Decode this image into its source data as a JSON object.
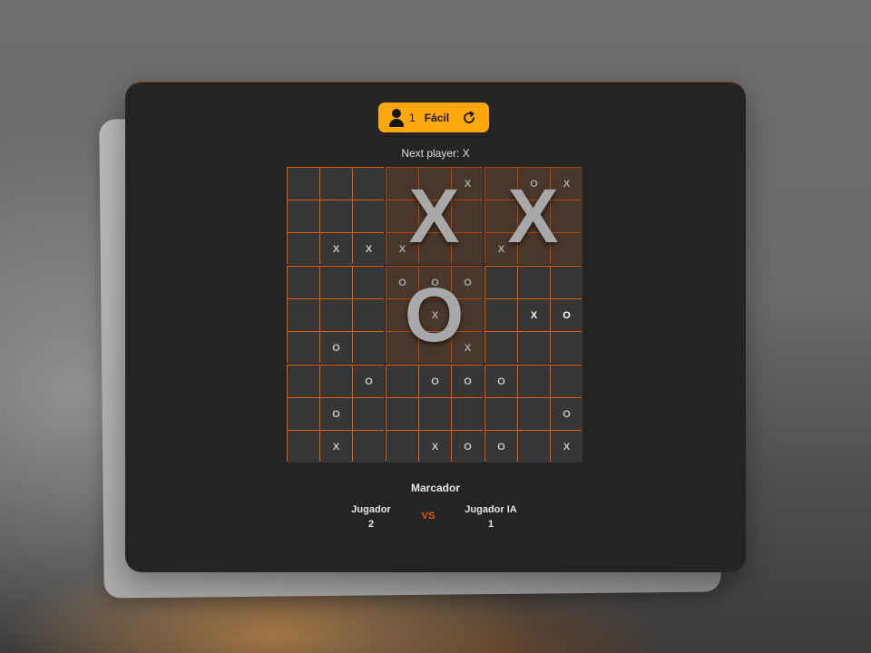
{
  "topbar": {
    "player_icon": "user-icon",
    "player_count": "1",
    "difficulty": "Fácil",
    "restart_icon": "refresh-icon",
    "accent_color": "#ffa70b"
  },
  "status": "Next player: X",
  "board": {
    "next_player": "X",
    "highlight_color": "#e65c00",
    "sub_boards": [
      {
        "winner": "",
        "cells": [
          "",
          "",
          "",
          "",
          "",
          "",
          "",
          "X",
          "X"
        ]
      },
      {
        "winner": "X",
        "cells": [
          "",
          "",
          "X",
          "",
          "",
          "",
          "X",
          "",
          ""
        ]
      },
      {
        "winner": "X",
        "cells": [
          "",
          "O",
          "X",
          "",
          "",
          "",
          "X",
          "",
          ""
        ]
      },
      {
        "winner": "",
        "cells": [
          "",
          "",
          "",
          "",
          "",
          "",
          "",
          "O",
          ""
        ]
      },
      {
        "winner": "O",
        "cells": [
          "O",
          "O",
          "O",
          "",
          "X",
          "",
          "",
          "",
          "X"
        ]
      },
      {
        "winner": "",
        "cells": [
          "",
          "",
          "",
          "",
          "X",
          "O",
          "",
          "",
          ""
        ]
      },
      {
        "winner": "",
        "cells": [
          "",
          "",
          "O",
          "",
          "O",
          "",
          "",
          "X",
          ""
        ]
      },
      {
        "winner": "",
        "cells": [
          "",
          "O",
          "O",
          "",
          "",
          "",
          "",
          "X",
          "O"
        ]
      },
      {
        "winner": "",
        "cells": [
          "O",
          "",
          "",
          "",
          "",
          "O",
          "O",
          "",
          "X"
        ]
      }
    ]
  },
  "scoreboard": {
    "title": "Marcador",
    "player_label": "Jugador",
    "player_score": "2",
    "vs": "VS",
    "ai_label": "Jugador IA",
    "ai_score": "1"
  }
}
